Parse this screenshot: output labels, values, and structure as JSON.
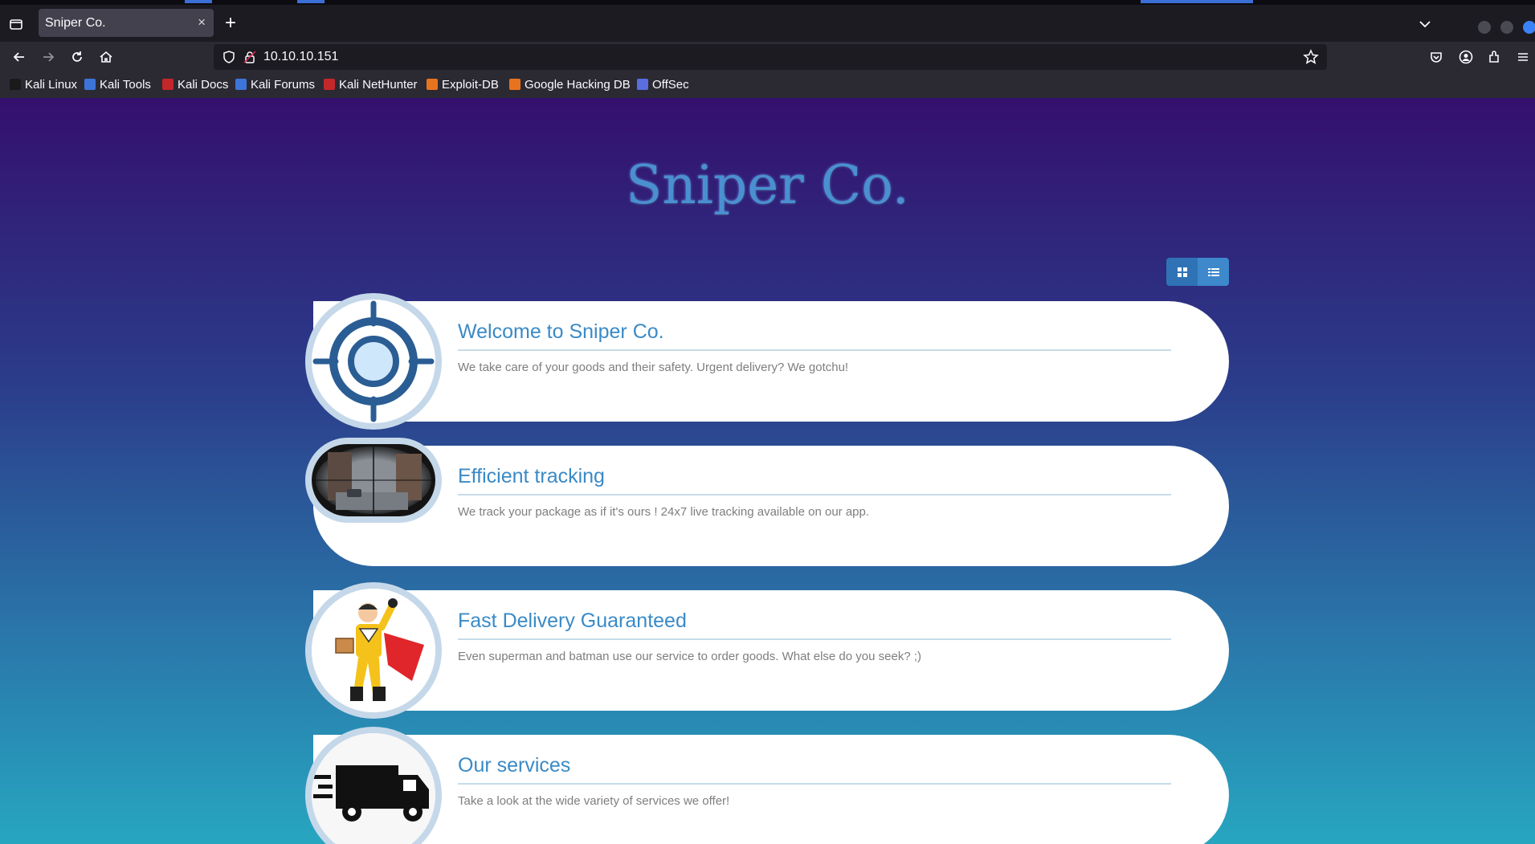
{
  "browser": {
    "tab_title": "Sniper Co.",
    "tab_close": "×",
    "new_tab": "+",
    "url": "10.10.10.151",
    "bookmarks": [
      {
        "label": "Kali Linux",
        "color": "#1a1a1a"
      },
      {
        "label": "Kali Tools",
        "color": "#3d74d8"
      },
      {
        "label": "Kali Docs",
        "color": "#c4272a"
      },
      {
        "label": "Kali Forums",
        "color": "#3d74d8"
      },
      {
        "label": "Kali NetHunter",
        "color": "#c4272a"
      },
      {
        "label": "Exploit-DB",
        "color": "#e8731f"
      },
      {
        "label": "Google Hacking DB",
        "color": "#e8731f"
      },
      {
        "label": "OffSec",
        "color": "#5a6ee0"
      }
    ]
  },
  "site": {
    "title": "Sniper Co.",
    "view_toggle": [
      "grid-icon",
      "list-icon"
    ],
    "cards": [
      {
        "title": "Welcome to Sniper Co.",
        "text": "We take care of your goods and their safety. Urgent delivery? We gotchu!",
        "image": "crosshair-icon"
      },
      {
        "title": "Efficient tracking",
        "text": "We track your package as if it's ours ! 24x7 live tracking available on our app.",
        "image": "scope-street-image"
      },
      {
        "title": "Fast Delivery Guaranteed",
        "text": "Even superman and batman use our service to order goods. What else do you seek? ;)",
        "image": "superhero-delivery-image"
      },
      {
        "title": "Our services",
        "text": "Take a look at the wide variety of services we offer!",
        "image": "delivery-truck-icon"
      }
    ]
  },
  "colors": {
    "gradient_top": "#34106e",
    "gradient_bottom": "#27a6c0",
    "accent": "#3a8ac6",
    "title": "#4a90d0"
  }
}
